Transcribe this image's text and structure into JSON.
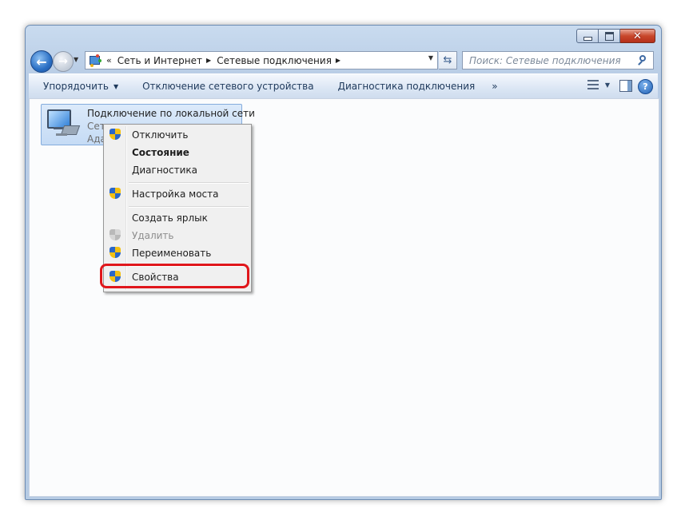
{
  "window": {
    "caption_buttons": [
      "minimize",
      "maximize",
      "close"
    ]
  },
  "address_bar": {
    "overflow": "«",
    "crumbs": [
      "Сеть и Интернет",
      "Сетевые подключения"
    ],
    "search_placeholder": "Поиск: Сетевые подключения"
  },
  "command_bar": {
    "organize": "Упорядочить",
    "disable_device": "Отключение сетевого устройства",
    "diagnose": "Диагностика подключения",
    "more": "»"
  },
  "item": {
    "title": "Подключение по локальной сети",
    "subtitle1": "Сеть",
    "subtitle2": "Адаптер"
  },
  "context_menu": {
    "items": [
      {
        "label": "Отключить",
        "shield": true
      },
      {
        "label": "Состояние",
        "bold": true
      },
      {
        "label": "Диагностика"
      },
      {
        "label": "Настройка моста",
        "shield": true
      },
      {
        "label": "Создать ярлык"
      },
      {
        "label": "Удалить",
        "shield": true,
        "disabled": true
      },
      {
        "label": "Переименовать",
        "shield": true
      },
      {
        "label": "Свойства",
        "shield": true,
        "highlighted": true
      }
    ]
  },
  "colors": {
    "highlight_outline": "#e0161b",
    "selection": "#c5dbf5"
  },
  "icons": [
    "back-arrow-icon",
    "forward-arrow-icon",
    "network-folder-icon",
    "refresh-icon",
    "search-icon",
    "view-options-icon",
    "preview-pane-icon",
    "help-icon",
    "network-adapter-icon",
    "uac-shield-icon"
  ]
}
